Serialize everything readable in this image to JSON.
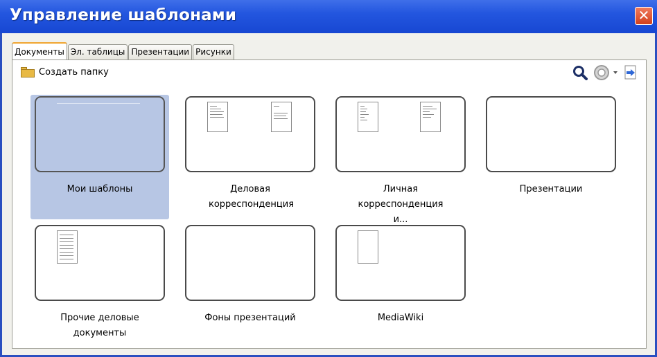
{
  "window": {
    "title": "Управление шаблонами",
    "close_glyph": "✕"
  },
  "tabs": [
    "Документы",
    "Эл. таблицы",
    "Презентации",
    "Рисунки"
  ],
  "active_tab": 0,
  "toolbar": {
    "new_folder_label": "Создать папку",
    "icons": [
      "search-icon",
      "settings-icon",
      "dropdown-arrow-icon",
      "import-icon"
    ]
  },
  "templates": [
    {
      "label": "Мои шаблоны",
      "selected": true
    },
    {
      "label": "Деловая корреспонденция"
    },
    {
      "label": "Личная корреспонденция и..."
    },
    {
      "label": "Презентации"
    },
    {
      "label": "Прочие деловые документы"
    },
    {
      "label": "Фоны презентаций"
    },
    {
      "label": "MediaWiki"
    }
  ],
  "colors": {
    "title_bar": "#2356df",
    "selection": "#b7c6e4",
    "active_tab_accent": "#f0a530",
    "close_button": "#d2401c"
  }
}
